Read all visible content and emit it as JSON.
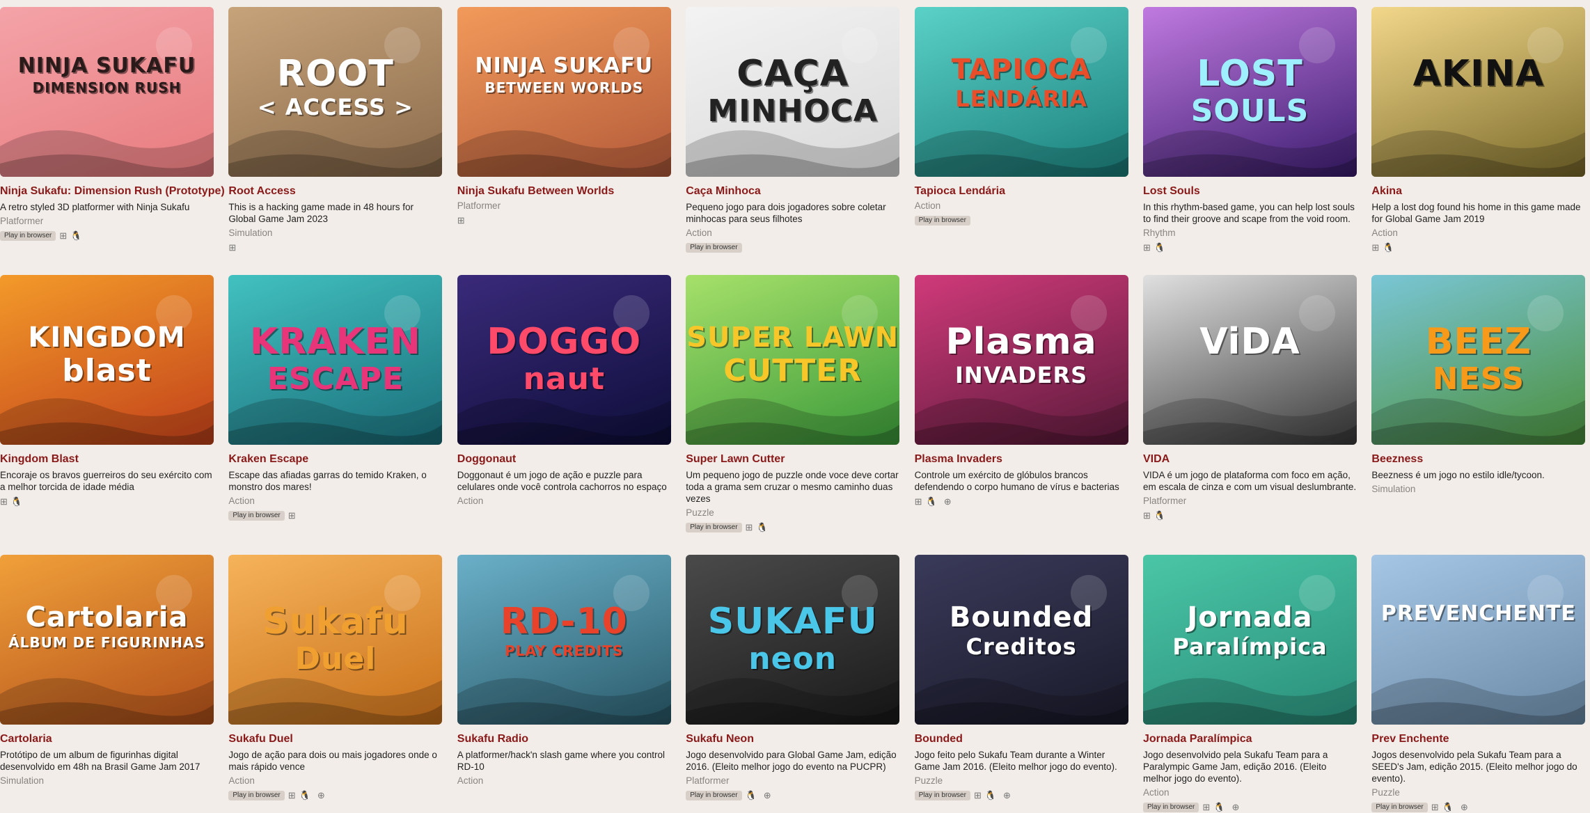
{
  "icons": {
    "windows": "⊞",
    "linux": "🐧",
    "apple": "",
    "android": "⊕"
  },
  "games": [
    {
      "title": "Ninja Sukafu: Dimension Rush (Prototype)",
      "description": "A retro styled 3D platformer with Ninja Sukafu",
      "genre": "Platformer",
      "browser": "Play in browser",
      "platforms": [
        "windows",
        "linux",
        "apple"
      ],
      "cover": {
        "line1": "NINJA SUKAFU",
        "line2": "DIMENSION RUSH",
        "bg1": "#f4a3a8",
        "bg2": "#e77b7e",
        "color": "#2a1a1a",
        "icon": "ninja-icon"
      }
    },
    {
      "title": "Root Access",
      "description": "This is a hacking game made in 48 hours for Global Game Jam 2023",
      "genre": "Simulation",
      "browser": "",
      "platforms": [
        "windows",
        "apple"
      ],
      "cover": {
        "line1": "ROOT",
        "line2": "< ACCESS >",
        "bg1": "#c7a37a",
        "bg2": "#8a6b4c",
        "color": "#ffffff",
        "icon": "monitor-icon"
      }
    },
    {
      "title": "Ninja Sukafu Between Worlds",
      "description": "",
      "genre": "Platformer",
      "browser": "",
      "platforms": [
        "windows",
        "apple"
      ],
      "cover": {
        "line1": "NINJA SUKAFU",
        "line2": "BETWEEN WORLDS",
        "bg1": "#f29a5a",
        "bg2": "#b35a3a",
        "color": "#ffffff",
        "icon": "torii-icon"
      }
    },
    {
      "title": "Caça Minhoca",
      "description": "Pequeno jogo para dois jogadores sobre coletar minhocas para seus filhotes",
      "genre": "Action",
      "browser": "Play in browser",
      "platforms": [],
      "cover": {
        "line1": "CAÇA",
        "line2": "MINHOCA",
        "bg1": "#f3f3f3",
        "bg2": "#d9d9d9",
        "color": "#222222",
        "icon": "worm-icon"
      }
    },
    {
      "title": "Tapioca Lendária",
      "description": "",
      "genre": "Action",
      "browser": "Play in browser",
      "platforms": [],
      "cover": {
        "line1": "TAPIOCA",
        "line2": "LENDÁRIA",
        "bg1": "#5ad1c7",
        "bg2": "#1a7e7a",
        "color": "#e94e2b",
        "icon": "map-icon"
      }
    },
    {
      "title": "Lost Souls",
      "description": "In this rhythm-based game, you can help lost souls to find their groove and scape from the void room.",
      "genre": "Rhythm",
      "browser": "",
      "platforms": [
        "windows",
        "linux",
        "apple"
      ],
      "cover": {
        "line1": "LOST",
        "line2": "SOULS",
        "bg1": "#c07ae0",
        "bg2": "#3b1c6e",
        "color": "#9ff0ff",
        "icon": "soul-icon"
      }
    },
    {
      "title": "Akina",
      "description": "Help a lost dog found his home in this game made for Global Game Jam 2019",
      "genre": "Action",
      "browser": "",
      "platforms": [
        "windows",
        "linux",
        "apple"
      ],
      "cover": {
        "line1": "AKINA",
        "line2": "",
        "bg1": "#f2d78a",
        "bg2": "#7a6a2a",
        "color": "#111111",
        "icon": "dog-icon"
      }
    },
    {
      "title": "Kingdom Blast",
      "description": "Encoraje os bravos guerreiros do seu exército com a melhor torcida de idade média",
      "genre": "",
      "browser": "",
      "platforms": [
        "windows",
        "linux",
        "apple"
      ],
      "cover": {
        "line1": "KINGDOM",
        "line2": "blast",
        "bg1": "#f39a2a",
        "bg2": "#c2411a",
        "color": "#ffffff",
        "icon": "castle-icon"
      }
    },
    {
      "title": "Kraken Escape",
      "description": "Escape das afiadas garras do temido Kraken, o monstro dos mares!",
      "genre": "Action",
      "browser": "Play in browser",
      "platforms": [
        "windows",
        "apple"
      ],
      "cover": {
        "line1": "KRAKEN",
        "line2": "ESCAPE",
        "bg1": "#42c1c0",
        "bg2": "#1a6e7a",
        "color": "#e8357a",
        "icon": "octopus-icon"
      }
    },
    {
      "title": "Doggonaut",
      "description": "Doggonaut é um jogo de ação e puzzle para celulares onde você controla cachorros no espaço",
      "genre": "Action",
      "browser": "",
      "platforms": [],
      "cover": {
        "line1": "DOGGO",
        "line2": "naut",
        "bg1": "#3a2a7a",
        "bg2": "#0e0e3a",
        "color": "#ff4a6a",
        "icon": "astronaut-dog-icon"
      }
    },
    {
      "title": "Super Lawn Cutter",
      "description": "Um pequeno jogo de puzzle onde voce deve cortar toda a grama sem cruzar o mesmo caminho duas vezes",
      "genre": "Puzzle",
      "browser": "Play in browser",
      "platforms": [
        "windows",
        "linux",
        "apple"
      ],
      "cover": {
        "line1": "SUPER LAWN",
        "line2": "CUTTER",
        "bg1": "#a6e06a",
        "bg2": "#3a9a3a",
        "color": "#f7c72a",
        "icon": "dragon-icon"
      }
    },
    {
      "title": "Plasma Invaders",
      "description": "Controle um exército de glóbulos brancos defendendo o corpo humano de vírus e bacterias",
      "genre": "",
      "browser": "",
      "platforms": [
        "windows",
        "linux",
        "apple",
        "android"
      ],
      "cover": {
        "line1": "Plasma",
        "line2": "INVADERS",
        "bg1": "#d03a7a",
        "bg2": "#5a1a3a",
        "color": "#ffffff",
        "icon": "cell-icon"
      }
    },
    {
      "title": "VIDA",
      "description": "VIDA é um jogo de plataforma com foco em ação, em escala de cinza e com um visual deslumbrante.",
      "genre": "Platformer",
      "browser": "",
      "platforms": [
        "windows",
        "linux",
        "apple"
      ],
      "cover": {
        "line1": "ViDA",
        "line2": "",
        "bg1": "#e0e0e0",
        "bg2": "#3a3a3a",
        "color": "#ffffff",
        "icon": "play-arrow-icon"
      }
    },
    {
      "title": "Beezness",
      "description": "Beezness é um jogo no estilo idle/tycoon.",
      "genre": "Simulation",
      "browser": "",
      "platforms": [],
      "cover": {
        "line1": "BEEZ",
        "line2": "NESS",
        "bg1": "#7ac6d6",
        "bg2": "#4a8e3a",
        "color": "#f79a1a",
        "icon": "beehive-icon"
      }
    },
    {
      "title": "Cartolaria",
      "description": "Protótipo de um album de figurinhas digital desenvolvido em 48h na Brasil Game Jam 2017",
      "genre": "Simulation",
      "browser": "",
      "platforms": [],
      "cover": {
        "line1": "Cartolaria",
        "line2": "ÁLBUM DE FIGURINHAS",
        "bg1": "#f0a03a",
        "bg2": "#b3501a",
        "color": "#ffffff",
        "icon": "top-hat-icon"
      }
    },
    {
      "title": "Sukafu Duel",
      "description": "Jogo de ação para dois ou mais jogadores onde o mais rápido vence",
      "genre": "Action",
      "browser": "Play in browser",
      "platforms": [
        "windows",
        "linux",
        "apple",
        "android"
      ],
      "cover": {
        "line1": "Sukafu",
        "line2": "Duel",
        "bg1": "#f6b35a",
        "bg2": "#c9701a",
        "color": "#f0a030",
        "icon": "cactus-icon"
      }
    },
    {
      "title": "Sukafu Radio",
      "description": "A platformer/hack'n slash game where you control RD-10",
      "genre": "Action",
      "browser": "",
      "platforms": [],
      "cover": {
        "line1": "RD-10",
        "line2": "PLAY  CREDITS",
        "bg1": "#6ab0c8",
        "bg2": "#2a5a6a",
        "color": "#e8432a",
        "icon": "radio-icon"
      }
    },
    {
      "title": "Sukafu Neon",
      "description": "Jogo desenvolvido para Global Game Jam, edição 2016. (Eleito melhor jogo do evento na PUCPR)",
      "genre": "Platformer",
      "browser": "Play in browser",
      "platforms": [
        "linux",
        "apple",
        "android"
      ],
      "cover": {
        "line1": "SUKAFU",
        "line2": "neon",
        "bg1": "#4a4a4a",
        "bg2": "#1a1a1a",
        "color": "#4ac6e8",
        "icon": "runner-icon"
      }
    },
    {
      "title": "Bounded",
      "description": "Jogo feito pelo Sukafu Team durante a Winter Game Jam 2016. (Eleito melhor jogo do evento).",
      "genre": "Puzzle",
      "browser": "Play in browser",
      "platforms": [
        "windows",
        "linux",
        "apple",
        "android"
      ],
      "cover": {
        "line1": "Bounded",
        "line2": "Creditos",
        "bg1": "#3a3a5a",
        "bg2": "#1a1a2a",
        "color": "#ffffff",
        "icon": "cursor-icon"
      }
    },
    {
      "title": "Jornada Paralímpica",
      "description": "Jogo desenvolvido pela Sukafu Team para a Paralympic Game Jam, edição 2016. (Eleito melhor jogo do evento).",
      "genre": "Action",
      "browser": "Play in browser",
      "platforms": [
        "windows",
        "linux",
        "apple",
        "android"
      ],
      "cover": {
        "line1": "Jornada",
        "line2": "Paralímpica",
        "bg1": "#4ac6a6",
        "bg2": "#2a8e7a",
        "color": "#ffffff",
        "icon": "torch-icon"
      }
    },
    {
      "title": "Prev Enchente",
      "description": "Jogos desenvolvido pela Sukafu Team para a SEED's Jam, edição 2015. (Eleito melhor jogo do evento).",
      "genre": "Puzzle",
      "browser": "Play in browser",
      "platforms": [
        "windows",
        "linux",
        "apple",
        "android"
      ],
      "cover": {
        "line1": "PREVENCHENTE",
        "line2": "",
        "bg1": "#a6c6e6",
        "bg2": "#6a8aa6",
        "color": "#ffffff",
        "icon": "city-icon"
      }
    }
  ]
}
